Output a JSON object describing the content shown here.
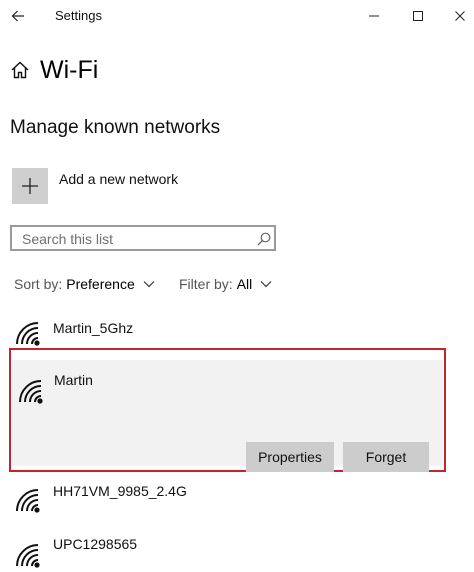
{
  "window": {
    "title": "Settings",
    "controls": {
      "minimize": "minimize",
      "maximize": "maximize",
      "close": "close"
    }
  },
  "header": {
    "title": "Wi-Fi"
  },
  "section": {
    "title": "Manage known networks"
  },
  "add_network": {
    "label": "Add a new network"
  },
  "search": {
    "placeholder": "Search this list"
  },
  "sort": {
    "label": "Sort by:",
    "value": "Preference"
  },
  "filter": {
    "label": "Filter by:",
    "value": "All"
  },
  "networks": [
    {
      "name": "Martin_5Ghz"
    },
    {
      "name": "Martin",
      "selected": true
    },
    {
      "name": "HH71VM_9985_2.4G"
    },
    {
      "name": "UPC1298565"
    }
  ],
  "selected_actions": {
    "properties": "Properties",
    "forget": "Forget"
  },
  "colors": {
    "selection_border": "#c0262d",
    "button_bg": "#cccccc",
    "panel_bg": "#f2f2f2"
  },
  "icons": [
    "back-arrow-icon",
    "home-icon",
    "plus-icon",
    "search-icon",
    "chevron-down-icon",
    "wifi-icon"
  ]
}
